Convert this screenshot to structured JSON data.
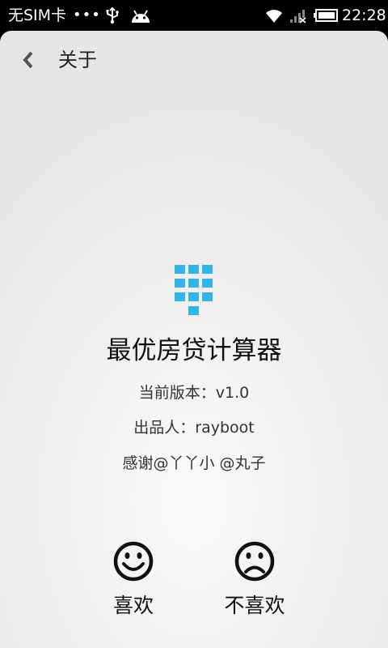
{
  "status_bar": {
    "carrier": "无SIM卡",
    "dots": "•••",
    "time": "22:28",
    "icons": [
      "usb-icon",
      "android-icon",
      "wifi-icon",
      "signal-no-sim-icon",
      "battery-icon"
    ]
  },
  "header": {
    "back_icon": "chevron-left-icon",
    "title": "关于"
  },
  "app": {
    "logo_icon": "keypad-logo-icon",
    "name": "最优房贷计算器",
    "version": "当前版本：v1.0",
    "author": "出品人：rayboot",
    "thanks": "感谢@丫丫小 @丸子"
  },
  "feedback": {
    "like_label": "喜欢",
    "like_icon": "smiley-face-icon",
    "dislike_label": "不喜欢",
    "dislike_icon": "sad-face-icon"
  },
  "colors": {
    "accent": "#33B5E5",
    "status_bar_bg": "#000000",
    "text": "#111111"
  }
}
